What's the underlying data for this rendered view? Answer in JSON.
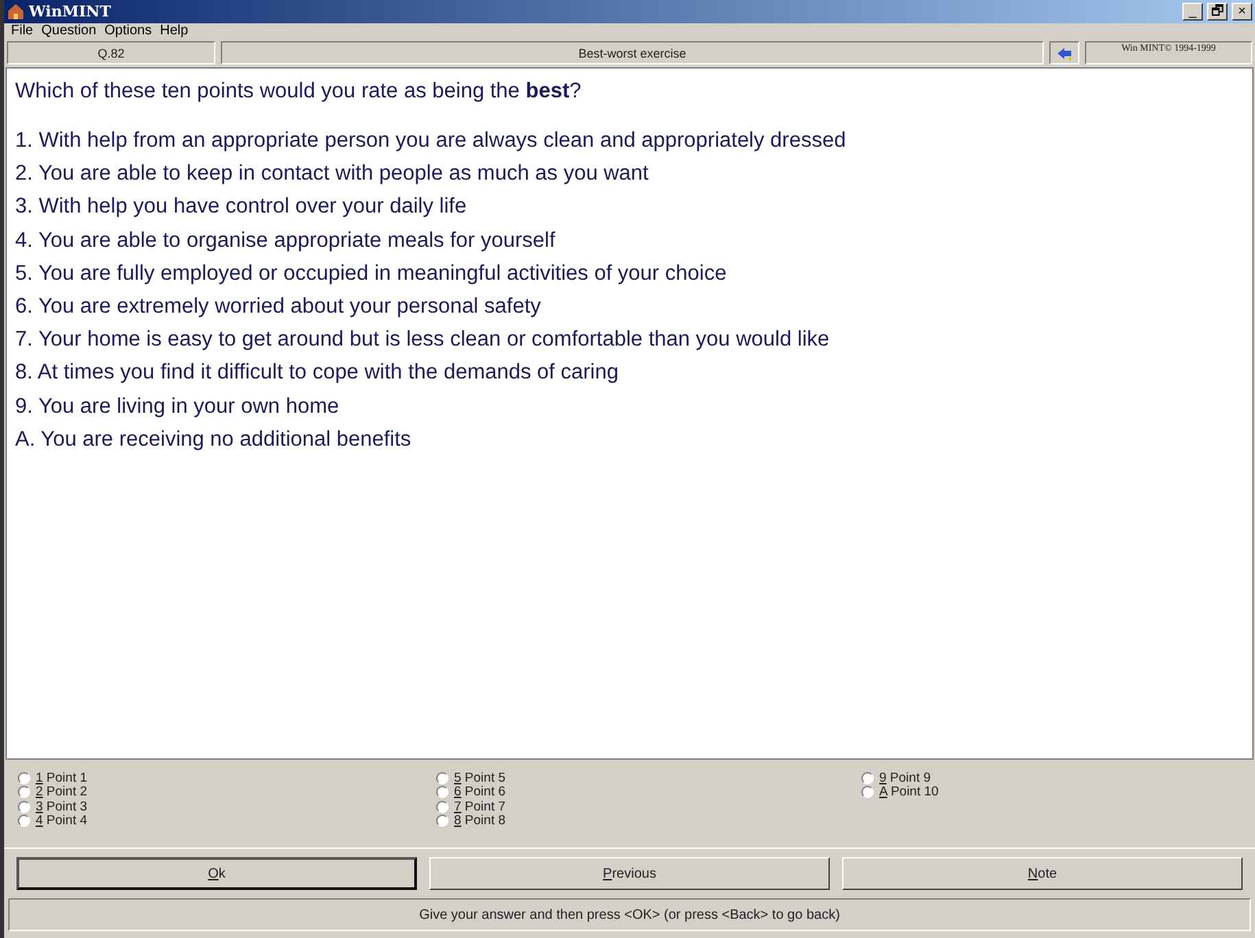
{
  "window": {
    "title": "WinMINT",
    "controls": [
      "_",
      "🗗",
      "×"
    ]
  },
  "menu": [
    "File",
    "Question",
    "Options",
    "Help"
  ],
  "header": {
    "question_number": "Q.82",
    "title": "Best-worst exercise",
    "copyright": "Win MINT© 1994-1999"
  },
  "question": "Which of these ten points would you rate as being the **best**?",
  "points": [
    "1. With help from an appropriate person you are always clean and appropriately dressed",
    "2. You are able to keep in contact with people as much as you want",
    "3. With help you have control over your daily life",
    "4. You are able to organise appropriate meals for yourself",
    "5. You are fully employed or occupied in meaningful activities of your choice",
    "6. You are extremely worried about your personal safety",
    "7. Your home is easy to get around but is less clean or comfortable than you would like",
    "8. At times you find it difficult to cope with the demands of caring",
    "9. You are living in your own home",
    "A. You are receiving no additional benefits"
  ],
  "options": [
    [
      {
        "key": "1",
        "label": "Point 1",
        "selected": false
      },
      {
        "key": "2",
        "label": "Point 2",
        "selected": false
      },
      {
        "key": "3",
        "label": "Point 3",
        "selected": false
      },
      {
        "key": "4",
        "label": "Point 4",
        "selected": false
      }
    ],
    [
      {
        "key": "5",
        "label": "Point 5",
        "selected": false
      },
      {
        "key": "6",
        "label": "Point 6",
        "selected": false
      },
      {
        "key": "7",
        "label": "Point 7",
        "selected": false
      },
      {
        "key": "8",
        "label": "Point 8",
        "selected": false
      }
    ],
    [
      {
        "key": "9",
        "label": "Point 9",
        "selected": false
      },
      {
        "key": "A",
        "label": "Point 10",
        "selected": false
      }
    ]
  ],
  "buttons": [
    {
      "label": "Ok",
      "default": true
    },
    {
      "label": "Previous",
      "default": false
    },
    {
      "label": "Note",
      "default": false
    }
  ],
  "status_bar": "Give your answer and then press <OK> (or press <Back> to go back)"
}
